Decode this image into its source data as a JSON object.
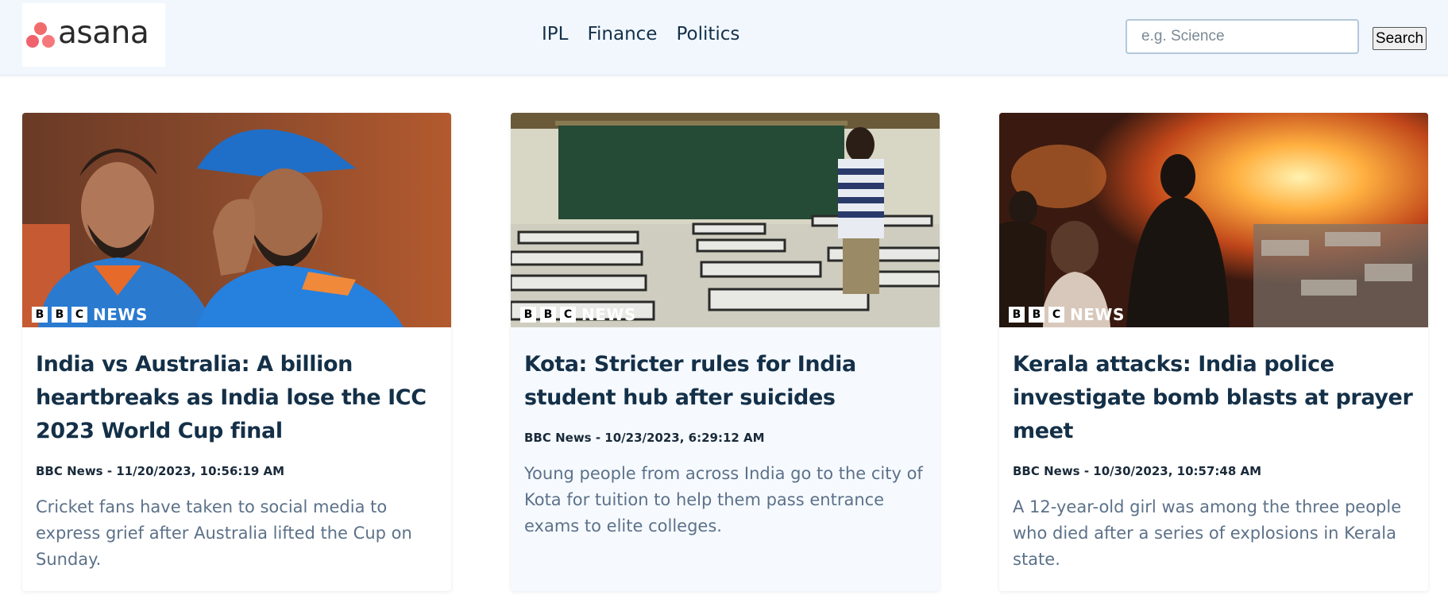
{
  "brand": {
    "name": "asana",
    "colors": {
      "dot": "#f06a6a"
    }
  },
  "nav": {
    "links": [
      "IPL",
      "Finance",
      "Politics"
    ]
  },
  "search": {
    "placeholder": "e.g. Science",
    "button_label": "Search"
  },
  "image_watermark": [
    "B",
    "B",
    "C",
    "NEWS"
  ],
  "colors": {
    "title": "#143048",
    "description": "#5c7189",
    "navbar_bg": "#f1f7fd"
  },
  "articles": [
    {
      "title": "India vs Australia: A billion heartbreaks as India lose the ICC 2023 World Cup final",
      "meta": "BBC News - 11/20/2023, 10:56:19 AM",
      "description": "Cricket fans have taken to social media to express grief after Australia lifted the Cup on Sunday."
    },
    {
      "title": "Kota: Stricter rules for India student hub after suicides",
      "meta": "BBC News - 10/23/2023, 6:29:12 AM",
      "description": "Young people from across India go to the city of Kota for tuition to help them pass entrance exams to elite colleges."
    },
    {
      "title": "Kerala attacks: India police investigate bomb blasts at prayer meet",
      "meta": "BBC News - 10/30/2023, 10:57:48 AM",
      "description": "A 12-year-old girl was among the three people who died after a series of explosions in Kerala state."
    }
  ]
}
